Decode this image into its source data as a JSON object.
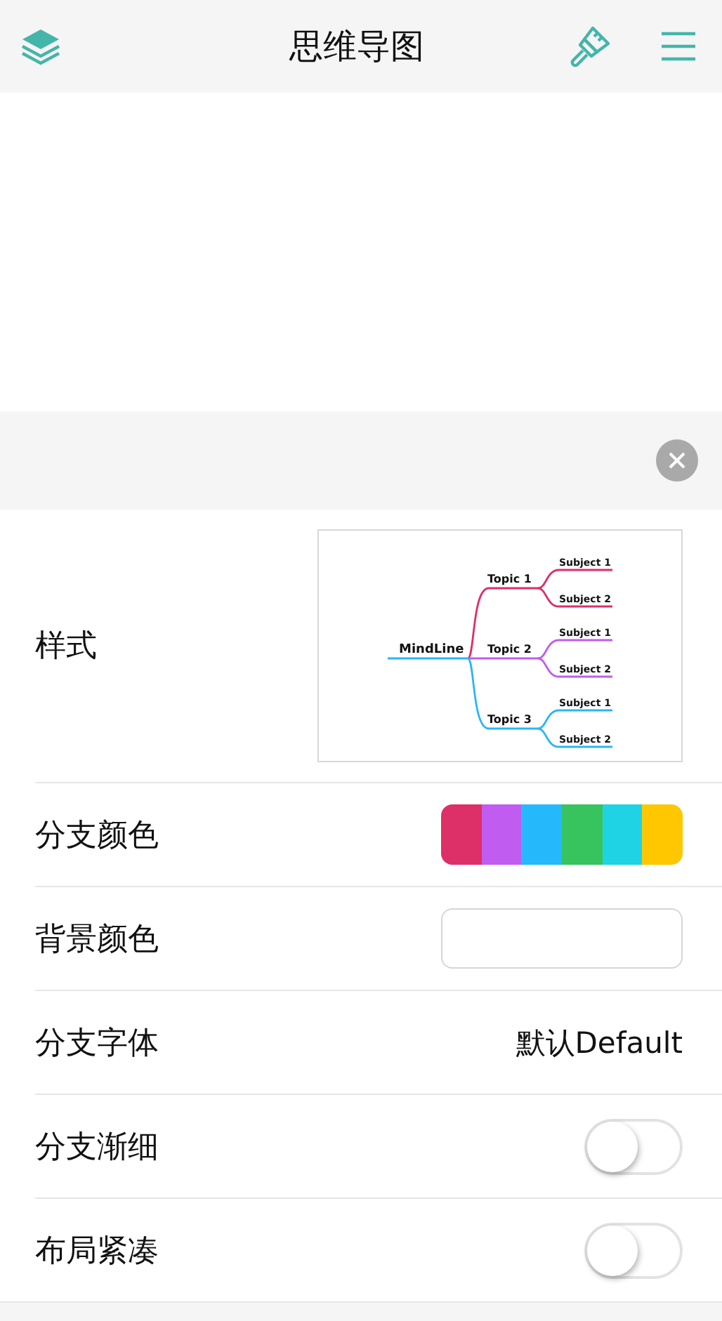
{
  "header": {
    "title": "思维导图"
  },
  "rows": [
    {
      "kind": "preview",
      "label": "样式",
      "map": {
        "root": "MindLine",
        "topics": [
          {
            "name": "Topic 1",
            "color": "#dd2f68",
            "subjects": [
              "Subject 1",
              "Subject 2"
            ]
          },
          {
            "name": "Topic 2",
            "color": "#c05cf0",
            "subjects": [
              "Subject 1",
              "Subject 2"
            ]
          },
          {
            "name": "Topic 3",
            "color": "#2ab6f5",
            "subjects": [
              "Subject 1",
              "Subject 2"
            ]
          }
        ]
      }
    },
    {
      "kind": "palette",
      "label": "分支颜色",
      "colors": [
        {
          "color": "#dd2f68"
        },
        {
          "color": "#c05cf0"
        },
        {
          "color": "#25b9fb"
        },
        {
          "color": "#37c45f"
        },
        {
          "color": "#1fd3e5"
        },
        {
          "color": "#ffc700"
        }
      ]
    },
    {
      "kind": "color",
      "label": "背景颜色"
    },
    {
      "kind": "font",
      "label": "分支字体",
      "value": "默认Default"
    },
    {
      "kind": "toggle",
      "label": "分支渐细",
      "on": false
    },
    {
      "kind": "toggle",
      "label": "布局紧凑",
      "on": false
    }
  ]
}
